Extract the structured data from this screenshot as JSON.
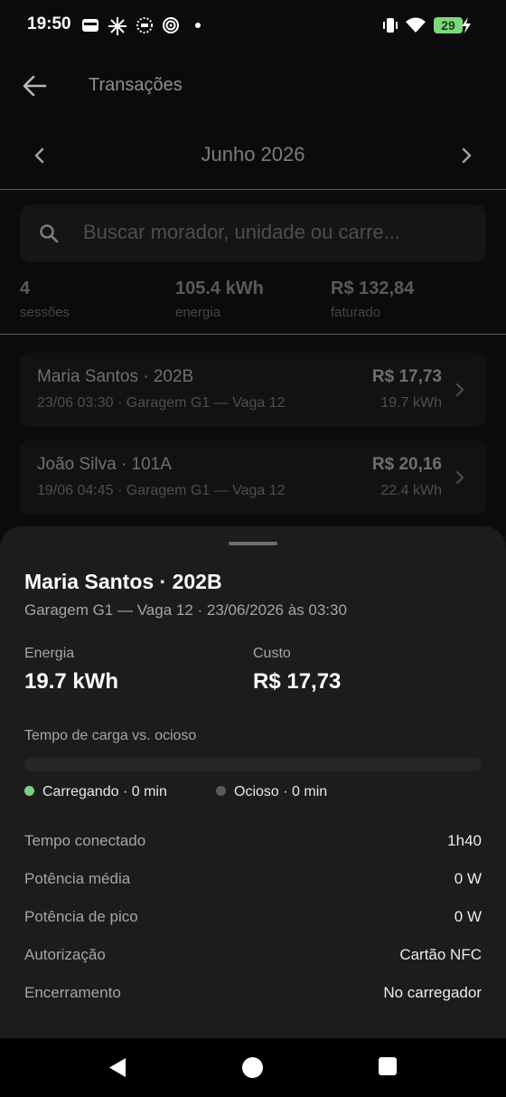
{
  "status_bar": {
    "time": "19:50",
    "battery_level": "29",
    "icons": [
      "wallet-icon",
      "sparkle-icon",
      "dotted-circle-icon",
      "spiral-icon",
      "dot-icon",
      "vibrate-icon",
      "wifi-icon",
      "battery-icon",
      "charging-bolt-icon"
    ]
  },
  "header": {
    "title": "Transações",
    "back_icon": "arrow-left-icon"
  },
  "month_nav": {
    "label": "Junho 2026"
  },
  "search": {
    "placeholder": "Buscar morador, unidade ou carre..."
  },
  "summary": {
    "sessions_value": "4",
    "sessions_label": "sessões",
    "energy_value": "105.4 kWh",
    "energy_label": "energia",
    "billed_value": "R$ 132,84",
    "billed_label": "faturado"
  },
  "transactions": [
    {
      "name": "Maria Santos · 202B",
      "detail": "23/06 03:30 · Garagem G1 — Vaga 12",
      "amount": "R$ 17,73",
      "energy": "19.7 kWh"
    },
    {
      "name": "João Silva · 101A",
      "detail": "19/06 04:45 · Garagem G1 — Vaga 12",
      "amount": "R$ 20,16",
      "energy": "22.4 kWh"
    }
  ],
  "sheet": {
    "title": "Maria Santos · 202B",
    "subtitle": "Garagem G1 — Vaga 12 · 23/06/2026 às 03:30",
    "energy_label": "Energia",
    "energy_value": "19.7 kWh",
    "cost_label": "Custo",
    "cost_value": "R$ 17,73",
    "bar_label": "Tempo de carga vs. ocioso",
    "charging_fraction": 0,
    "legend_charging": "Carregando · 0 min",
    "legend_idle": "Ocioso · 0 min",
    "details": [
      {
        "label": "Tempo conectado",
        "value": "1h40"
      },
      {
        "label": "Potência média",
        "value": "0 W"
      },
      {
        "label": "Potência de pico",
        "value": "0 W"
      },
      {
        "label": "Autorização",
        "value": "Cartão NFC"
      },
      {
        "label": "Encerramento",
        "value": "No carregador"
      }
    ]
  },
  "colors": {
    "charging": "#7ccf86",
    "idle": "#5a5a5a",
    "battery": "#7dd87d"
  }
}
